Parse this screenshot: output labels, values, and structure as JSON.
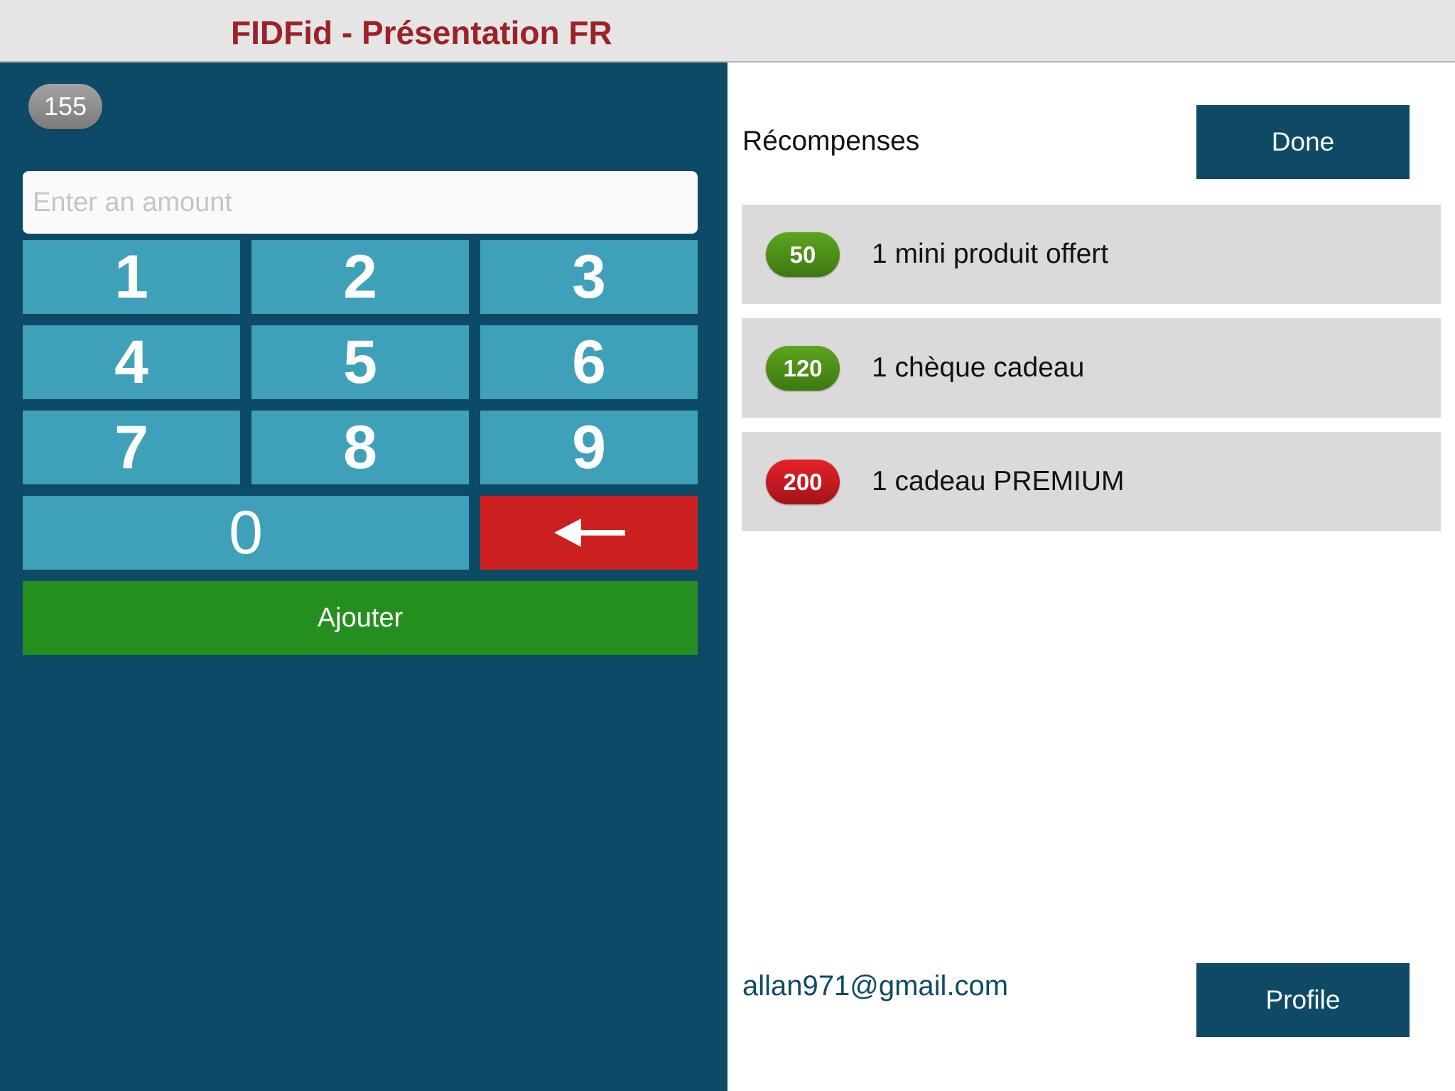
{
  "header": {
    "title": "FIDFid - Présentation FR"
  },
  "left_panel": {
    "points_balance": "155",
    "amount_input": {
      "placeholder": "Enter an amount",
      "value": ""
    },
    "keypad": {
      "keys": [
        "1",
        "2",
        "3",
        "4",
        "5",
        "6",
        "7",
        "8",
        "9",
        "0"
      ],
      "backspace_icon": "arrow-left-icon"
    },
    "add_button_label": "Ajouter"
  },
  "right_panel": {
    "rewards_title": "Récompenses",
    "done_label": "Done",
    "rewards": [
      {
        "points": "50",
        "label": "1 mini produit offert",
        "badge_color": "#4f911a"
      },
      {
        "points": "120",
        "label": "1 chèque cadeau",
        "badge_color": "#4f911a"
      },
      {
        "points": "200",
        "label": "1 cadeau PREMIUM",
        "badge_color": "#cc1c22"
      }
    ],
    "user_email": "allan971@gmail.com",
    "profile_label": "Profile"
  },
  "colors": {
    "header_bg": "#e5e5e5",
    "title": "#9b2327",
    "panel_bg": "#0d4a67",
    "key_bg": "#3fa0ba",
    "backspace_bg": "#cc1f1f",
    "add_bg": "#248f1f",
    "dark_button": "#0e4a66",
    "reward_row_bg": "#dadada"
  }
}
